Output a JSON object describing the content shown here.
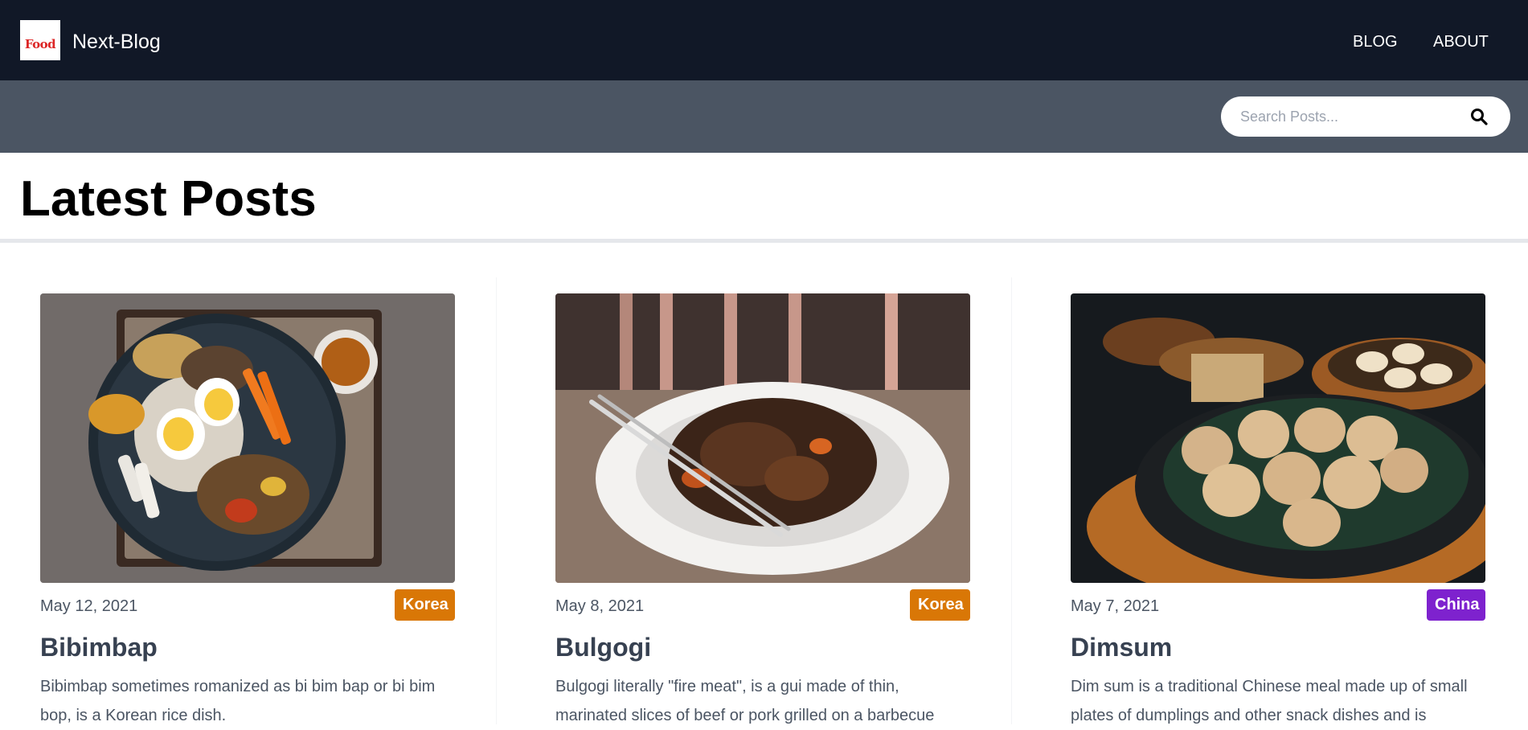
{
  "header": {
    "logo_text": "Food",
    "brand": "Next-Blog",
    "nav": [
      {
        "label": "BLOG"
      },
      {
        "label": "ABOUT"
      }
    ]
  },
  "search": {
    "placeholder": "Search Posts...",
    "value": ""
  },
  "page": {
    "title": "Latest Posts"
  },
  "posts": [
    {
      "date": "May 12, 2021",
      "category": "Korea",
      "category_color": "#d97706",
      "title": "Bibimbap",
      "excerpt": "Bibimbap sometimes romanized as bi bim bap or bi bim bop, is a Korean rice dish."
    },
    {
      "date": "May 8, 2021",
      "category": "Korea",
      "category_color": "#d97706",
      "title": "Bulgogi",
      "excerpt": "Bulgogi literally \"fire meat\", is a gui made of thin, marinated slices of beef or pork grilled on a barbecue"
    },
    {
      "date": "May 7, 2021",
      "category": "China",
      "category_color": "#7e22ce",
      "title": "Dimsum",
      "excerpt": "Dim sum is a traditional Chinese meal made up of small plates of dumplings and other snack dishes and is"
    }
  ],
  "colors": {
    "navbar": "#111827",
    "subbar": "#4b5563",
    "korea_badge": "#d97706",
    "china_badge": "#7e22ce"
  }
}
